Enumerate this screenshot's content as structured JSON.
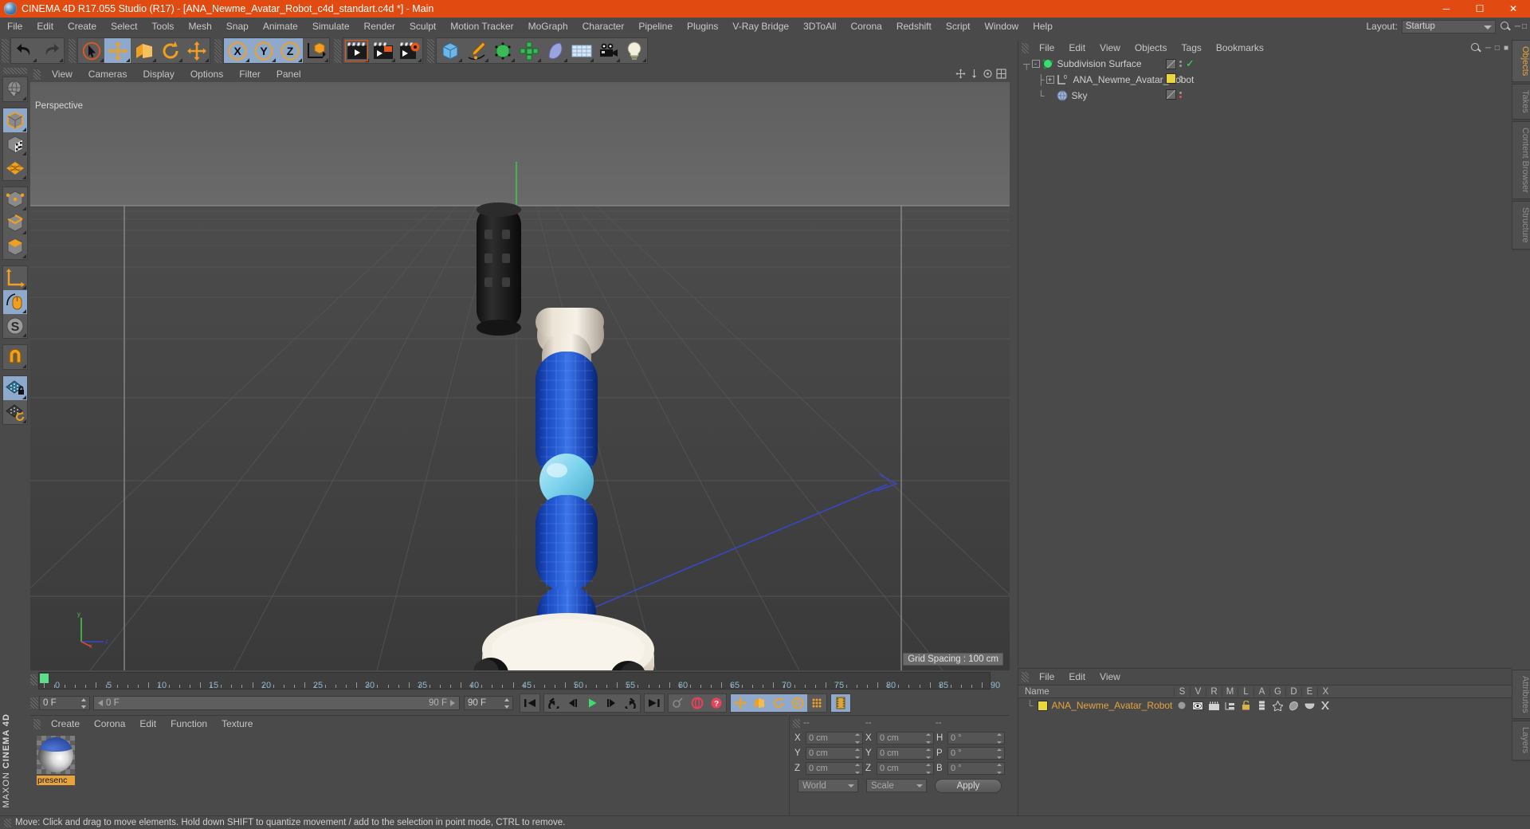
{
  "window": {
    "title": "CINEMA 4D R17.055 Studio (R17) - [ANA_Newme_Avatar_Robot_c4d_standart.c4d *] - Main",
    "minimize": "─",
    "maximize": "☐",
    "close": "✕"
  },
  "menubar": {
    "items": [
      "File",
      "Edit",
      "Create",
      "Select",
      "Tools",
      "Mesh",
      "Snap",
      "Animate",
      "Simulate",
      "Render",
      "Sculpt",
      "Motion Tracker",
      "MoGraph",
      "Character",
      "Pipeline",
      "Plugins",
      "V-Ray Bridge",
      "3DToAll",
      "Corona",
      "Redshift",
      "Script",
      "Window",
      "Help"
    ],
    "layout_label": "Layout:",
    "layout_value": "Startup"
  },
  "toolbar": {
    "groups": [
      {
        "name": "history",
        "buttons": [
          {
            "name": "undo-button",
            "icon": "undo"
          },
          {
            "name": "redo-button",
            "icon": "redo"
          }
        ]
      },
      {
        "name": "transform",
        "buttons": [
          {
            "name": "select-tool-button",
            "icon": "cursor-circle"
          },
          {
            "name": "move-tool-button",
            "icon": "move",
            "active": true
          },
          {
            "name": "scale-tool-button",
            "icon": "scale"
          },
          {
            "name": "rotate-tool-button",
            "icon": "rotate"
          },
          {
            "name": "dynamic-move-button",
            "icon": "move2"
          }
        ]
      },
      {
        "name": "axis-lock",
        "buttons": [
          {
            "name": "lock-x-button",
            "icon": "axis-x",
            "active": true
          },
          {
            "name": "lock-y-button",
            "icon": "axis-y",
            "active": true
          },
          {
            "name": "lock-z-button",
            "icon": "axis-z",
            "active": true
          },
          {
            "name": "world-object-coord-button",
            "icon": "world-axis"
          }
        ]
      },
      {
        "name": "render-group",
        "buttons": [
          {
            "name": "render-view-button",
            "icon": "render-view"
          },
          {
            "name": "render-region-button",
            "icon": "render-region"
          },
          {
            "name": "render-settings-button",
            "icon": "render-settings"
          }
        ]
      },
      {
        "name": "create-group",
        "buttons": [
          {
            "name": "cube-primitive-button",
            "icon": "cube"
          },
          {
            "name": "spline-pen-button",
            "icon": "pen"
          },
          {
            "name": "generator-button",
            "icon": "generator"
          },
          {
            "name": "deformer-button",
            "icon": "deformer"
          },
          {
            "name": "nurbs-button",
            "icon": "nurbs"
          },
          {
            "name": "scene-object-button",
            "icon": "floor"
          },
          {
            "name": "camera-button",
            "icon": "camera"
          },
          {
            "name": "light-button",
            "icon": "light"
          }
        ]
      }
    ]
  },
  "left_palette": {
    "groups": [
      [
        {
          "name": "live-selection-tool",
          "icon": "globe-select"
        }
      ],
      [
        {
          "name": "model-mode-button",
          "icon": "cube-model",
          "active": true
        },
        {
          "name": "texture-mode-button",
          "icon": "cube-texture"
        },
        {
          "name": "workplane-button",
          "icon": "grid-plane"
        }
      ],
      [
        {
          "name": "points-mode-button",
          "icon": "cube-points"
        },
        {
          "name": "edges-mode-button",
          "icon": "cube-edges"
        },
        {
          "name": "polygons-mode-button",
          "icon": "cube-polys"
        }
      ],
      [
        {
          "name": "enable-axis-button",
          "icon": "axis-arrow"
        },
        {
          "name": "viewport-solo-button",
          "icon": "mouse",
          "active": true
        },
        {
          "name": "soft-selection-button",
          "icon": "s-circle"
        }
      ],
      [
        {
          "name": "snap-magnet-button",
          "icon": "magnet"
        }
      ],
      [
        {
          "name": "workplane-lock-button",
          "icon": "plane-lock",
          "active": true
        },
        {
          "name": "workplane-rotate-button",
          "icon": "plane-rotate"
        }
      ]
    ],
    "brand_line1": "MAXON",
    "brand_line2": "CINEMA 4D"
  },
  "viewport": {
    "menu": [
      "View",
      "Cameras",
      "Display",
      "Options",
      "Filter",
      "Panel"
    ],
    "label": "Perspective",
    "grid_spacing": "Grid Spacing : 100 cm",
    "axis_labels": {
      "x": "x",
      "y": "y",
      "z": "z"
    }
  },
  "object_manager": {
    "menu": [
      "File",
      "Edit",
      "View",
      "Objects",
      "Tags",
      "Bookmarks"
    ],
    "rows": [
      {
        "name": "Subdivision Surface",
        "icon": "subdivision-surface",
        "indent": 0,
        "expander": "-",
        "tag": "hidden",
        "check": true,
        "color": "#9a9a9a"
      },
      {
        "name": "ANA_Newme_Avatar_Robot",
        "icon": "null-object",
        "indent": 1,
        "expander": "+",
        "tag": "material",
        "check": false,
        "color": "#e8d83c"
      },
      {
        "name": "Sky",
        "icon": "sky",
        "indent": 1,
        "expander": "",
        "tag": "hidden",
        "check": false,
        "dotcolor": "#e05050"
      }
    ]
  },
  "attribute_manager": {
    "menu": [
      "File",
      "Edit",
      "View"
    ],
    "columns": [
      "Name",
      "S",
      "V",
      "R",
      "M",
      "L",
      "A",
      "G",
      "D",
      "E",
      "X"
    ],
    "row": {
      "name": "ANA_Newme_Avatar_Robot",
      "color": "#e8d83c"
    }
  },
  "timeline": {
    "ticks": [
      0,
      5,
      10,
      15,
      20,
      25,
      30,
      35,
      40,
      45,
      50,
      55,
      60,
      65,
      70,
      75,
      80,
      85,
      90
    ],
    "current_frame": "0 F",
    "start_field": "0 F",
    "preview_min": "0 F",
    "preview_max": "90 F",
    "end_field": "90 F",
    "transport": [
      {
        "name": "go-to-start-button",
        "icon": "skip-back"
      },
      {
        "name": "previous-keyframe-button",
        "icon": "prev-key"
      },
      {
        "name": "step-back-button",
        "icon": "step-back"
      },
      {
        "name": "play-button",
        "icon": "play"
      },
      {
        "name": "step-forward-button",
        "icon": "step-fwd"
      },
      {
        "name": "next-keyframe-button",
        "icon": "next-key"
      },
      {
        "name": "go-to-end-button",
        "icon": "skip-fwd"
      }
    ],
    "record_tools": [
      {
        "name": "autokeying-button",
        "icon": "key"
      },
      {
        "name": "record-active-objects-button",
        "icon": "record-red"
      },
      {
        "name": "auto-keyframing-button",
        "icon": "question-red"
      }
    ],
    "key_filters": [
      {
        "name": "position-key-button",
        "icon": "move",
        "active": true
      },
      {
        "name": "scale-key-button",
        "icon": "scale",
        "active": true
      },
      {
        "name": "rotation-key-button",
        "icon": "rotate",
        "active": true
      },
      {
        "name": "param-key-button",
        "icon": "p-circle",
        "active": true
      },
      {
        "name": "point-level-anim-button",
        "icon": "dots-grid"
      }
    ],
    "extra": [
      {
        "name": "timeline-toggle-button",
        "icon": "film",
        "active": true
      }
    ]
  },
  "material_manager": {
    "menu": [
      "Create",
      "Corona",
      "Edit",
      "Function",
      "Texture"
    ],
    "materials": [
      {
        "name": "presenc",
        "label": "presenc"
      }
    ]
  },
  "coordinate_manager": {
    "headers": [
      "--",
      "--",
      "--"
    ],
    "position": {
      "label_x": "X",
      "label_y": "Y",
      "label_z": "Z",
      "x": "0 cm",
      "y": "0 cm",
      "z": "0 cm"
    },
    "size": {
      "label_x": "X",
      "label_y": "Y",
      "label_z": "Z",
      "x": "0 cm",
      "y": "0 cm",
      "z": "0 cm"
    },
    "rotation": {
      "label_h": "H",
      "label_p": "P",
      "label_b": "B",
      "h": "0 °",
      "p": "0 °",
      "b": "0 °"
    },
    "coord_system": "World",
    "size_mode": "Scale",
    "apply_label": "Apply"
  },
  "status_bar": {
    "message": "Move: Click and drag to move elements. Hold down SHIFT to quantize movement / add to the selection in point mode, CTRL to remove."
  },
  "right_tabs_top": [
    "Objects",
    "Takes",
    "Content Browser",
    "Structure"
  ],
  "right_tabs_bottom": [
    "Attributes",
    "Layers"
  ],
  "colors": {
    "accent_orange": "#e14a10",
    "panel_bg": "#4a4a4a",
    "text": "#c8c8c8",
    "highlight_blue": "#8fa9cc",
    "robot_blue": "#1b4fc4",
    "robot_cyan": "#7fd4ee",
    "robot_cream": "#ece4d6"
  }
}
